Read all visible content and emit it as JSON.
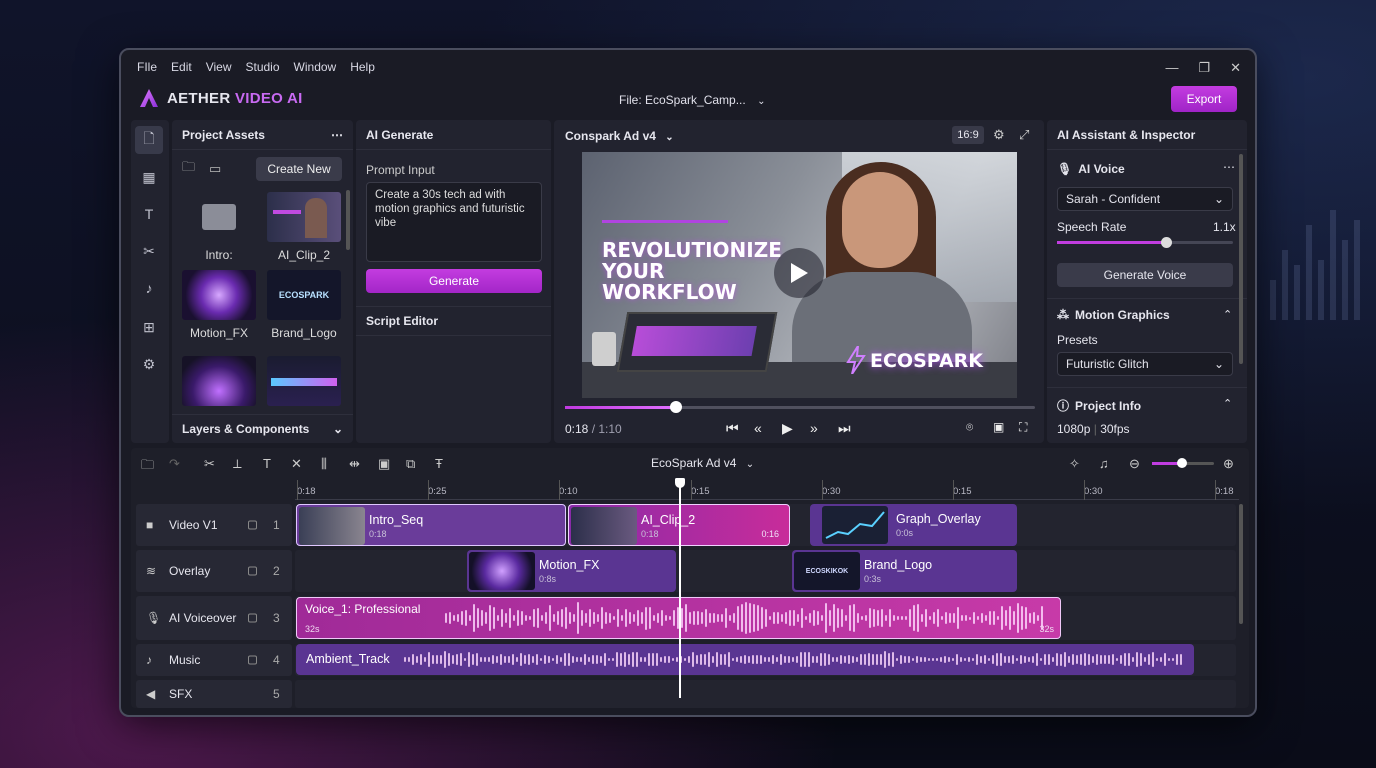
{
  "menu": [
    "FIle",
    "Edit",
    "View",
    "Studio",
    "Window",
    "Help"
  ],
  "app": {
    "name_main": "AETHER",
    "name_accent": "VIDEO AI",
    "file_label": "File: EcoSpark_Camp...",
    "export_label": "Export"
  },
  "assets": {
    "title": "Project Assets",
    "create_label": "Create New",
    "tiles": [
      {
        "caption": "Intro:"
      },
      {
        "caption": "AI_Clip_2"
      },
      {
        "caption": "Motion_FX"
      },
      {
        "caption": "Brand_Logo",
        "thumb_text": "ECOSPARK"
      },
      {
        "caption": ""
      },
      {
        "caption": ""
      }
    ],
    "layers_label": "Layers & Components"
  },
  "ai_generate": {
    "title": "AI Generate",
    "prompt_label": "Prompt Input",
    "prompt_value": "Create a 30s tech ad with motion graphics and futuristic vibe",
    "generate_label": "Generate",
    "script_label": "Script Editor"
  },
  "preview": {
    "title": "Conspark Ad v4",
    "ratio": "16:9",
    "headline_1": "REVOLUTIONIZE",
    "headline_2": "YOUR",
    "headline_3": "WORKFLOW",
    "brand": "ECOSPARK",
    "time_current": "0:18",
    "time_total": " / 1:10",
    "progress": 0.236
  },
  "inspector": {
    "title": "AI Assistant & Inspector",
    "voice_head": "AI Voice",
    "voice_value": "Sarah - Confident",
    "rate_label": "Speech Rate",
    "rate_value": "1.1x",
    "rate_fraction": 0.62,
    "gen_voice_label": "Generate Voice",
    "motion_head": "Motion Graphics",
    "presets_label": "Presets",
    "preset_value": "Futuristic Glitch",
    "info_head": "Project Info",
    "resolution": "1080p",
    "fps": "30fps"
  },
  "timeline": {
    "title": "EcoSpark Ad v4",
    "zoom_fraction": 0.48,
    "ruler": [
      "0:18",
      "0:25",
      "0:10",
      "0:15",
      "0:30",
      "0:15",
      "0:30",
      "0:18"
    ],
    "tracks": [
      {
        "name": "Video V1",
        "num": "1"
      },
      {
        "name": "Overlay",
        "num": "2"
      },
      {
        "name": "AI Voiceover",
        "num": "3"
      },
      {
        "name": "Music",
        "num": "4"
      },
      {
        "name": "SFX",
        "num": "5"
      }
    ],
    "clips": {
      "intro": {
        "title": "Intro_Seq",
        "dur": "0:18"
      },
      "aiclip": {
        "title": "AI_Clip_2",
        "dur": "0:18",
        "dur_right": "0:16"
      },
      "graph": {
        "title": "Graph_Overlay",
        "dur": "0:0s"
      },
      "motion": {
        "title": "Motion_FX",
        "dur": "0:8s"
      },
      "brand": {
        "title": "Brand_Logo",
        "dur": "0:3s",
        "thumb_text": "ECOSKIKOK"
      },
      "voice": {
        "title": "Voice_1: Professional",
        "dur_left": "32s",
        "dur_right": "32s"
      },
      "music": {
        "title": "Ambient_Track"
      }
    }
  },
  "colors": {
    "accent": "#b836e0",
    "panel": "#22232f",
    "window": "#1a1b25"
  }
}
